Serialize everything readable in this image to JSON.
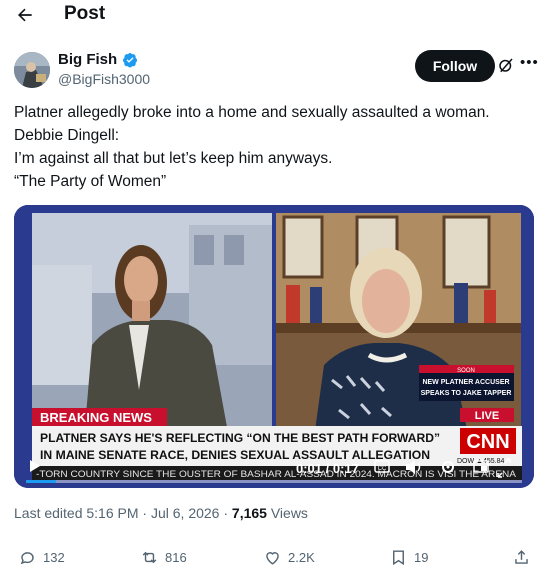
{
  "header": {
    "title": "Post"
  },
  "author": {
    "name": "Big Fish",
    "handle": "@BigFish3000"
  },
  "follow_label": "Follow",
  "post": {
    "lines": [
      "Platner allegedly broke into a home and sexually assaulted a woman.",
      "Debbie Dingell:",
      "I’m against all that but let’s keep him anyways.",
      "“The Party of Women”"
    ]
  },
  "video": {
    "breaking": "BREAKING NEWS",
    "headline1": "PLATNER SAYS HE'S REFLECTING “ON THE BEST PATH FORWARD”",
    "headline2": "IN MAINE SENATE RACE, DENIES SEXUAL ASSAULT ALLEGATION",
    "ticker": "-TORN COUNTRY SINCE THE OUSTER OF BASHAR AL-ASSAD IN 2024. MACRON IS VISI THE ARENA",
    "soon": "SOON",
    "promo1": "NEW PLATNER ACCUSER",
    "promo2": "SPEAKS TO JAKE TAPPER",
    "live": "LIVE",
    "network": "CNN",
    "dow": "DOW ▲455.84",
    "time": "0:01 / 0:17",
    "progress": 0.06
  },
  "meta": {
    "edited": "Last edited 5:16 PM · Jul 6, 2026 · ",
    "views_count": "7,165",
    "views_label": " Views"
  },
  "actions": {
    "replies": "132",
    "reposts": "816",
    "likes": "2.2K",
    "bookmarks": "19"
  },
  "colors": {
    "accent": "#1d9bf0",
    "breaking": "#c8102e",
    "cnn": "#cc0000"
  }
}
